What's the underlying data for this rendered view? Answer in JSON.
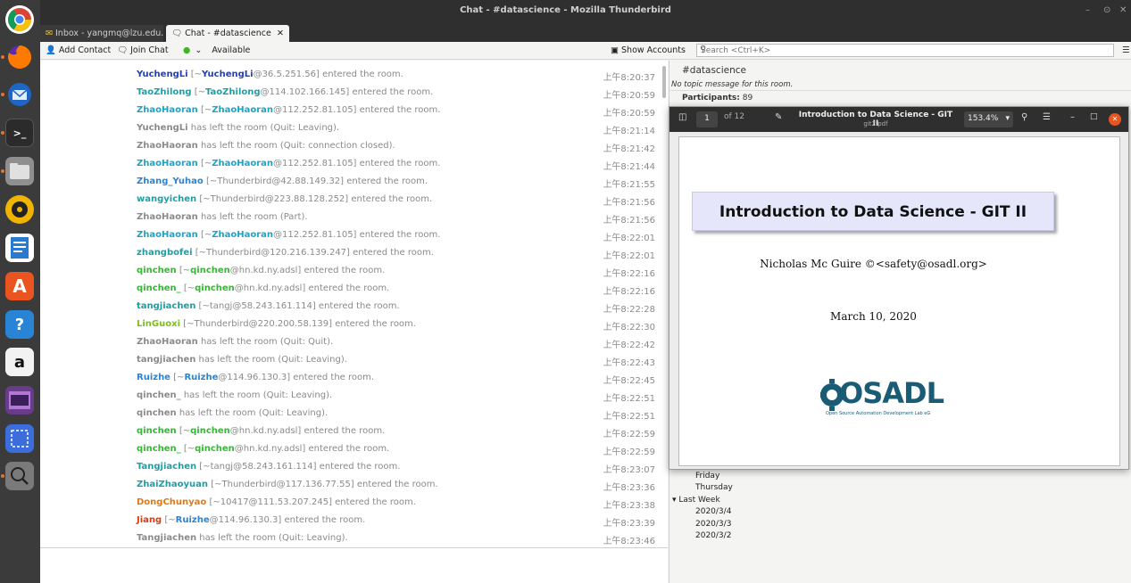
{
  "window": {
    "title": "Chat - #datascience - Mozilla Thunderbird",
    "controls": [
      "–",
      "⊙",
      "✕"
    ]
  },
  "tabs": [
    {
      "label": "Inbox - yangmq@lzu.edu...",
      "icon": "inbox-icon"
    },
    {
      "label": "Chat - #datascience",
      "icon": "chat-icon"
    }
  ],
  "toolbar": {
    "add_contact": "Add Contact",
    "join_chat": "Join Chat",
    "status": "Available",
    "show_accounts": "Show Accounts",
    "search_placeholder": "Search <Ctrl+K>"
  },
  "messages": [
    {
      "nick": "YuchengLi",
      "color": "#1f3fbf",
      "pre": " [~",
      "user": "YuchengLi",
      "ucolor": "#1f3fbf",
      "post": "@36.5.251.56] entered the room.",
      "time": "上午8:20:37"
    },
    {
      "nick": "TaoZhilong",
      "color": "#1aa0a8",
      "pre": " [~",
      "user": "TaoZhilong",
      "ucolor": "#1aa0a8",
      "post": "@114.102.166.145] entered the room.",
      "time": "上午8:20:59"
    },
    {
      "nick": "ZhaoHaoran",
      "color": "#19a4c9",
      "pre": " [~",
      "user": "ZhaoHaoran",
      "ucolor": "#19a4c9",
      "post": "@112.252.81.105] entered the room.",
      "time": "上午8:20:59"
    },
    {
      "nick": "YuchengLi",
      "color": "#8a8a8a",
      "pre": " has left the room (Quit: Leaving).",
      "user": "",
      "ucolor": "",
      "post": "",
      "time": "上午8:21:14"
    },
    {
      "nick": "ZhaoHaoran",
      "color": "#8a8a8a",
      "pre": " has left the room (Quit: connection closed).",
      "user": "",
      "ucolor": "",
      "post": "",
      "time": "上午8:21:42"
    },
    {
      "nick": "ZhaoHaoran",
      "color": "#19a4c9",
      "pre": " [~",
      "user": "ZhaoHaoran",
      "ucolor": "#19a4c9",
      "post": "@112.252.81.105] entered the room.",
      "time": "上午8:21:44"
    },
    {
      "nick": "Zhang_Yuhao",
      "color": "#2a84d6",
      "pre": " [~Thunderbird@42.88.149.32] entered the room.",
      "user": "",
      "ucolor": "",
      "post": "",
      "time": "上午8:21:55"
    },
    {
      "nick": "wangyichen",
      "color": "#1aa0a8",
      "pre": " [~Thunderbird@223.88.128.252] entered the room.",
      "user": "",
      "ucolor": "",
      "post": "",
      "time": "上午8:21:56"
    },
    {
      "nick": "ZhaoHaoran",
      "color": "#8a8a8a",
      "pre": " has left the room (Part).",
      "user": "",
      "ucolor": "",
      "post": "",
      "time": "上午8:21:56"
    },
    {
      "nick": "ZhaoHaoran",
      "color": "#19a4c9",
      "pre": " [~",
      "user": "ZhaoHaoran",
      "ucolor": "#19a4c9",
      "post": "@112.252.81.105] entered the room.",
      "time": "上午8:22:01"
    },
    {
      "nick": "zhangbofei",
      "color": "#1aa0a8",
      "pre": " [~Thunderbird@120.216.139.247] entered the room.",
      "user": "",
      "ucolor": "",
      "post": "",
      "time": "上午8:22:01"
    },
    {
      "nick": "qinchen",
      "color": "#2bbf2b",
      "pre": " [~",
      "user": "qinchen",
      "ucolor": "#2bbf2b",
      "post": "@hn.kd.ny.adsl] entered the room.",
      "time": "上午8:22:16"
    },
    {
      "nick": "qinchen_",
      "color": "#2bbf2b",
      "pre": " [~",
      "user": "qinchen",
      "ucolor": "#2bbf2b",
      "post": "@hn.kd.ny.adsl] entered the room.",
      "time": "上午8:22:16"
    },
    {
      "nick": "tangjiachen",
      "color": "#1aa0a8",
      "pre": " [~tangj@58.243.161.114] entered the room.",
      "user": "",
      "ucolor": "",
      "post": "",
      "time": "上午8:22:28"
    },
    {
      "nick": "LinGuoxi",
      "color": "#7bbf1a",
      "pre": " [~Thunderbird@220.200.58.139] entered the room.",
      "user": "",
      "ucolor": "",
      "post": "",
      "time": "上午8:22:30"
    },
    {
      "nick": "ZhaoHaoran",
      "color": "#8a8a8a",
      "pre": " has left the room (Quit: Quit).",
      "user": "",
      "ucolor": "",
      "post": "",
      "time": "上午8:22:42"
    },
    {
      "nick": "tangjiachen",
      "color": "#8a8a8a",
      "pre": " has left the room (Quit: Leaving).",
      "user": "",
      "ucolor": "",
      "post": "",
      "time": "上午8:22:43"
    },
    {
      "nick": "Ruizhe",
      "color": "#2a84d6",
      "pre": " [~",
      "user": "Ruizhe",
      "ucolor": "#2a84d6",
      "post": "@114.96.130.3] entered the room.",
      "time": "上午8:22:45"
    },
    {
      "nick": "qinchen_",
      "color": "#8a8a8a",
      "pre": " has left the room (Quit: Leaving).",
      "user": "",
      "ucolor": "",
      "post": "",
      "time": "上午8:22:51"
    },
    {
      "nick": "qinchen",
      "color": "#8a8a8a",
      "pre": " has left the room (Quit: Leaving).",
      "user": "",
      "ucolor": "",
      "post": "",
      "time": "上午8:22:51"
    },
    {
      "nick": "qinchen",
      "color": "#2bbf2b",
      "pre": " [~",
      "user": "qinchen",
      "ucolor": "#2bbf2b",
      "post": "@hn.kd.ny.adsl] entered the room.",
      "time": "上午8:22:59"
    },
    {
      "nick": "qinchen_",
      "color": "#2bbf2b",
      "pre": " [~",
      "user": "qinchen",
      "ucolor": "#2bbf2b",
      "post": "@hn.kd.ny.adsl] entered the room.",
      "time": "上午8:22:59"
    },
    {
      "nick": "Tangjiachen",
      "color": "#1aa0a8",
      "pre": " [~tangj@58.243.161.114] entered the room.",
      "user": "",
      "ucolor": "",
      "post": "",
      "time": "上午8:23:07"
    },
    {
      "nick": "ZhaiZhaoyuan",
      "color": "#1aa0a8",
      "pre": " [~Thunderbird@117.136.77.55] entered the room.",
      "user": "",
      "ucolor": "",
      "post": "",
      "time": "上午8:23:36"
    },
    {
      "nick": "DongChunyao",
      "color": "#e07a10",
      "pre": " [~10417@111.53.207.245] entered the room.",
      "user": "",
      "ucolor": "",
      "post": "",
      "time": "上午8:23:38"
    },
    {
      "nick": "Jiang",
      "color": "#e03a10",
      "pre": " [~",
      "user": "Ruizhe",
      "ucolor": "#2a84d6",
      "post": "@114.96.130.3] entered the room.",
      "time": "上午8:23:39"
    },
    {
      "nick": "Tangjiachen",
      "color": "#8a8a8a",
      "pre": " has left the room (Quit: Leaving).",
      "user": "",
      "ucolor": "",
      "post": "",
      "time": "上午8:23:46"
    }
  ],
  "conversation": {
    "channel": "#datascience",
    "topic": "No topic message for this room.",
    "participants_label": "Participants:",
    "participants_count": "89",
    "history": [
      "Friday",
      "Thursday"
    ],
    "last_week_label": "Last Week",
    "last_week": [
      "2020/3/4",
      "2020/3/3",
      "2020/3/2"
    ]
  },
  "pdf": {
    "title": "Introduction to Data Science - GIT II",
    "filename": "git2.pdf",
    "page": "1",
    "of_pages": "of 12",
    "zoom": "153.4%",
    "slide_title": "Introduction to Data Science - GIT II",
    "author": "Nicholas Mc Guire ©<safety@osadl.org>",
    "date": "March 10, 2020",
    "logo_text": "OSADL",
    "logo_sub": "Open Source Automation Development Lab eG"
  },
  "dock": [
    {
      "name": "chrome-icon",
      "color": "#db4437"
    },
    {
      "name": "firefox-icon",
      "color": "#e66000"
    },
    {
      "name": "thunderbird-icon",
      "color": "#1f65c4"
    },
    {
      "name": "terminal-icon",
      "color": "#2b2b2b"
    },
    {
      "name": "files-icon",
      "color": "#8f8f8f"
    },
    {
      "name": "rhythmbox-icon",
      "color": "#f0b400"
    },
    {
      "name": "writer-icon",
      "color": "#2a7ad2"
    },
    {
      "name": "software-icon",
      "color": "#e95420"
    },
    {
      "name": "help-icon",
      "color": "#2a84d6"
    },
    {
      "name": "amazon-icon",
      "color": "#f2f2f2"
    },
    {
      "name": "video-icon",
      "color": "#6a3b8a"
    },
    {
      "name": "screenshot-icon",
      "color": "#3c6ddc"
    },
    {
      "name": "search-app-icon",
      "color": "#7a7a7a"
    }
  ]
}
